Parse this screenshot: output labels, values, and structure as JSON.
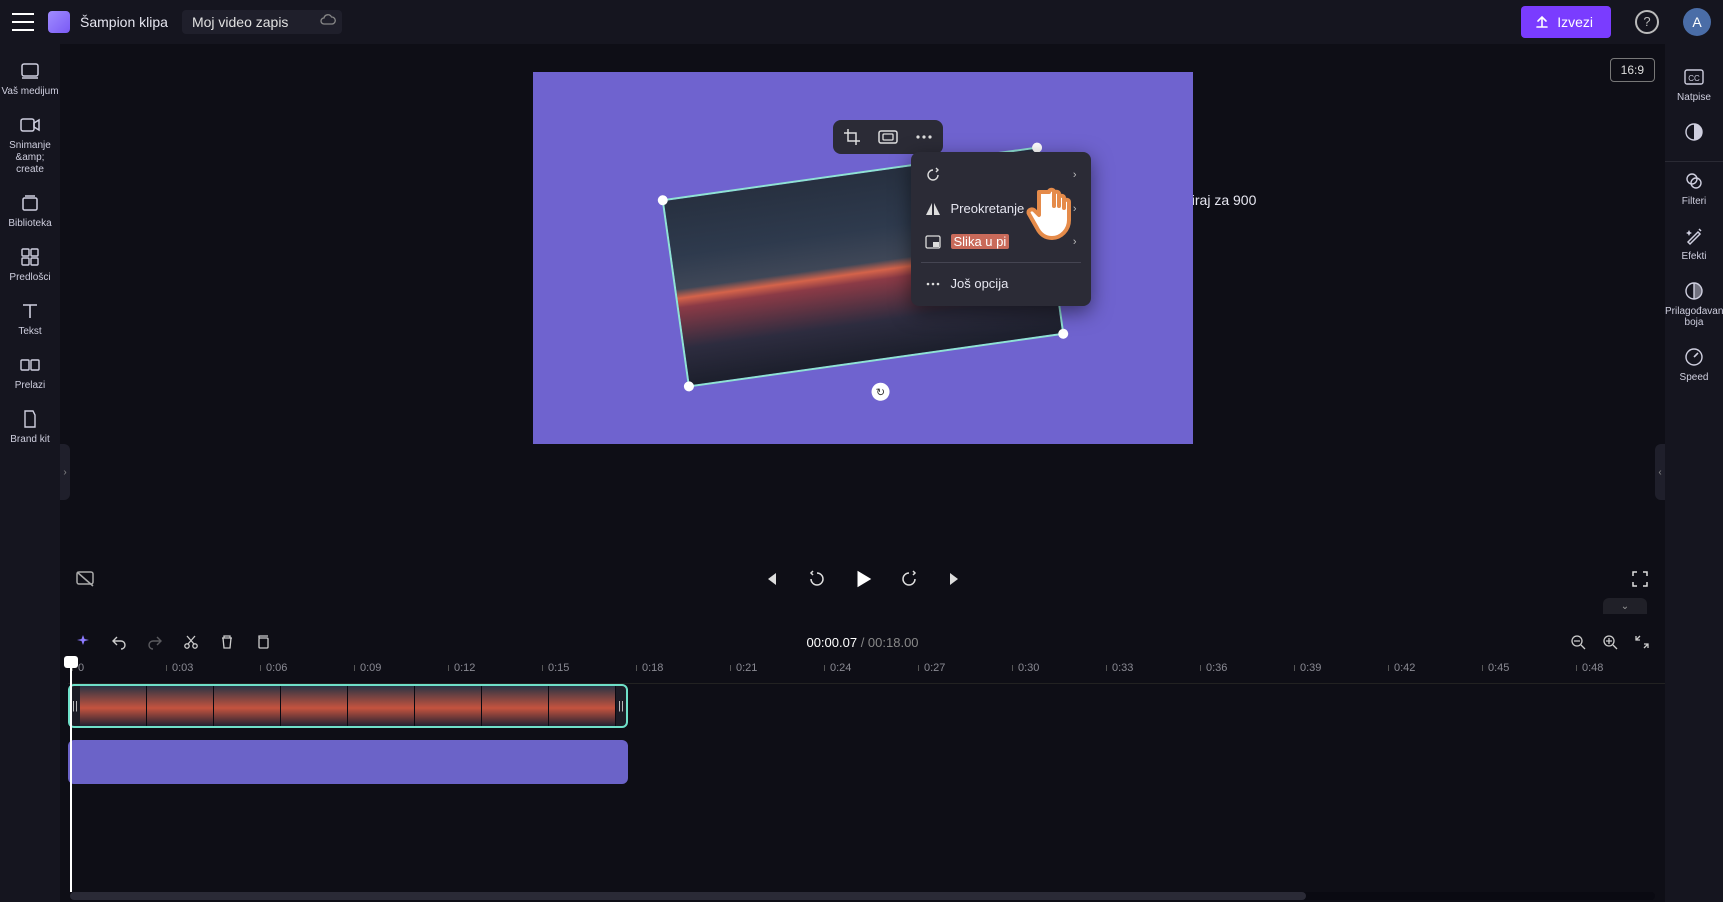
{
  "header": {
    "app_title": "Šampion klipa",
    "project_name": "Moj video zapis",
    "export_label": "Izvezi",
    "avatar_initial": "A"
  },
  "left_sidebar": {
    "items": [
      {
        "id": "your-media",
        "label": "Vaš medijum"
      },
      {
        "id": "record",
        "label": "Snimanje &amp;\ncreate"
      },
      {
        "id": "library",
        "label": "Biblioteka"
      },
      {
        "id": "templates",
        "label": "Predlošci"
      },
      {
        "id": "text",
        "label": "Tekst"
      },
      {
        "id": "transitions",
        "label": "Prelazi"
      },
      {
        "id": "brand-kit",
        "label": "Brand kit"
      }
    ]
  },
  "right_sidebar": {
    "items": [
      {
        "id": "captions",
        "label": "Natpise"
      },
      {
        "id": "contrast",
        "label": ""
      },
      {
        "id": "filters",
        "label": "Filteri"
      },
      {
        "id": "effects",
        "label": "Efekti"
      },
      {
        "id": "coloradj",
        "label": "Prilagođavanje boja"
      },
      {
        "id": "speed",
        "label": "Speed"
      }
    ]
  },
  "preview": {
    "aspect_ratio": "16:9",
    "annotation_text": "Rotiraj za 900",
    "floating_toolbar": [
      "crop",
      "fit",
      "more"
    ],
    "context_menu": {
      "items": [
        {
          "id": "rotate",
          "label": "",
          "has_submenu": true
        },
        {
          "id": "flip",
          "label": "Preokretanje",
          "has_submenu": true
        },
        {
          "id": "pip",
          "label": "Slika u pi",
          "has_submenu": true,
          "highlighted": true
        }
      ],
      "more_label": "Još opcija"
    }
  },
  "playback": {
    "current_time": "00:00.07",
    "total_time": "00:18.00"
  },
  "timeline": {
    "ticks": [
      "0",
      "0:03",
      "0:06",
      "0:09",
      "0:12",
      "0:15",
      "0:18",
      "0:21",
      "0:24",
      "0:27",
      "0:30",
      "0:33",
      "0:36",
      "0:39",
      "0:42",
      "0:45",
      "0:48",
      "0"
    ]
  }
}
